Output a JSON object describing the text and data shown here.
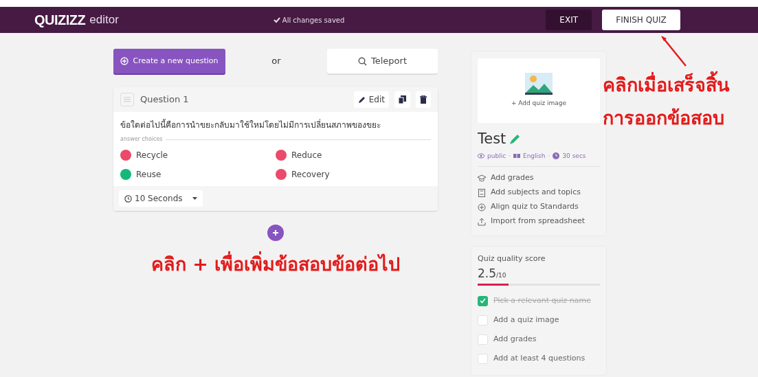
{
  "navbar": {
    "logo": "QUIZIZZ",
    "app": "editor",
    "save_status": "All changes saved",
    "buttons": [
      {
        "label": "EXIT",
        "kind": "dark"
      },
      {
        "label": "FINISH QUIZ",
        "kind": "light"
      }
    ]
  },
  "actions": {
    "create": "Create a new question",
    "or": "or",
    "teleport": "Teleport"
  },
  "question": {
    "title": "Question 1",
    "edit": "Edit",
    "text": "ข้อใดต่อไปนี้คือการนำขยะกลับมาใช้ใหม่โดยไม่มีการเปลี่ยนสภาพของขยะ",
    "choices_label": "answer choices",
    "choices": [
      {
        "text": "Recycle",
        "correct": false
      },
      {
        "text": "Reduce",
        "correct": false
      },
      {
        "text": "Reuse",
        "correct": true
      },
      {
        "text": "Recovery",
        "correct": false
      }
    ],
    "timer": "10 Seconds"
  },
  "add_note": "คลิก + เพื่อเพิ่มข้อสอบข้อต่อไป",
  "quiz": {
    "image_label": "+ Add quiz image",
    "title": "Test",
    "separator": "·",
    "meta": [
      {
        "text": "public",
        "kind": "eye"
      },
      {
        "text": "English",
        "kind": "language"
      },
      {
        "text": "30 secs",
        "kind": "clock"
      }
    ],
    "links": [
      {
        "text": "Add grades",
        "kind": "grad"
      },
      {
        "text": "Add subjects and topics",
        "kind": "book"
      },
      {
        "text": "Align quiz to Standards",
        "kind": "plus"
      },
      {
        "text": "Import from spreadsheet",
        "kind": "upload"
      }
    ]
  },
  "quality": {
    "label": "Quiz quality score",
    "score": "2.5",
    "out_of": "/10",
    "level": 0.25,
    "checklist": [
      {
        "text": "Pick a relevant quiz name",
        "checked": true
      },
      {
        "text": "Add a quiz image",
        "checked": false
      },
      {
        "text": "Add grades",
        "checked": false
      },
      {
        "text": "Add at least 4 questions",
        "checked": false
      }
    ]
  },
  "finish_note": [
    "คลิกเมื่อเสร็จสิ้น",
    "การออกข้อสอบ"
  ]
}
